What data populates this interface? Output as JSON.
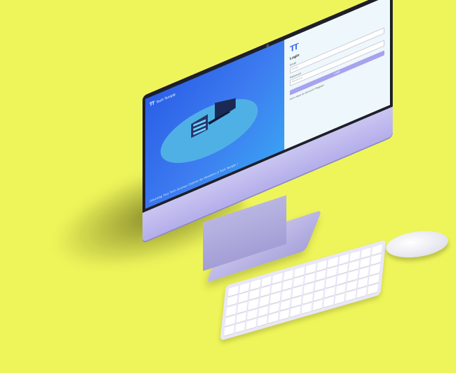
{
  "brand": {
    "logo": "TT",
    "name": "Tech Temple"
  },
  "hero": {
    "tagline": "Unlocking Your Tech Journey: Explore the Wonders of Tech Temple !"
  },
  "login": {
    "logo": "TT",
    "title": "Login",
    "email_label": "Email",
    "email_placeholder": "Email",
    "password_label": "Password",
    "password_placeholder": "Password",
    "button_label": "Login",
    "signup_text": "Don't have an account? Register"
  },
  "colors": {
    "background": "#eef55a",
    "accent": "#2a5fe6",
    "button": "#a8a2ee"
  }
}
